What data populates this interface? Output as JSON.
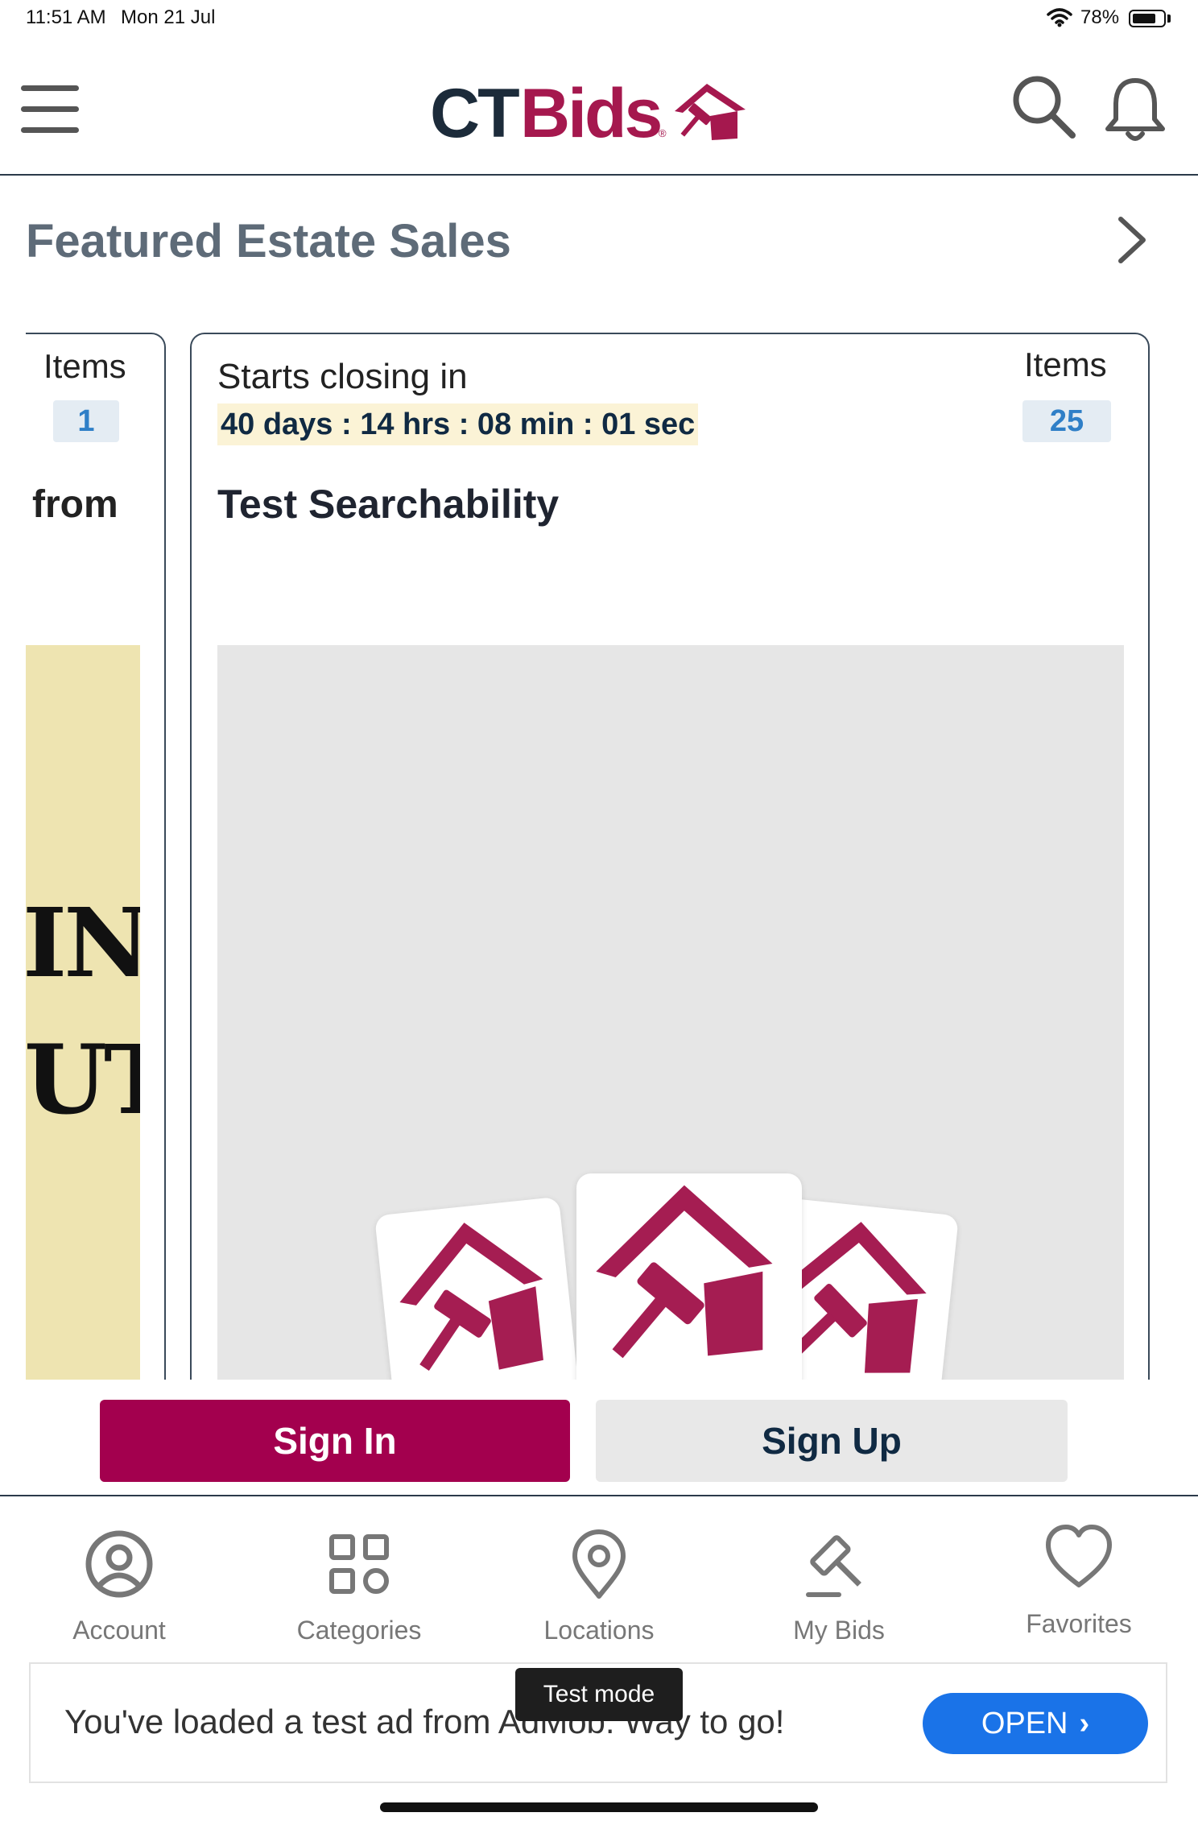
{
  "status_bar": {
    "time": "11:51 AM",
    "date": "Mon 21 Jul",
    "battery": "78%"
  },
  "header": {
    "logo_ct": "CT",
    "logo_bids": "Bids",
    "logo_reg": "®",
    "brand_color": "#a5184e",
    "dark_color": "#1c2b3a"
  },
  "section": {
    "title": "Featured Estate Sales"
  },
  "cards": [
    {
      "items_label": "Items",
      "items_count": "1",
      "from_label": "from",
      "image_text_line1": "IN",
      "image_text_line2": "UT"
    },
    {
      "closing_label": "Starts closing in",
      "countdown": "40 days : 14 hrs : 08 min : 01 sec",
      "items_label": "Items",
      "items_count": "25",
      "title": "Test Searchability"
    }
  ],
  "auth": {
    "sign_in": "Sign In",
    "sign_up": "Sign Up"
  },
  "tabs": [
    {
      "label": "Account",
      "icon": "account-icon"
    },
    {
      "label": "Categories",
      "icon": "categories-icon"
    },
    {
      "label": "Locations",
      "icon": "location-pin-icon"
    },
    {
      "label": "My Bids",
      "icon": "gavel-icon"
    },
    {
      "label": "Favorites",
      "icon": "heart-icon"
    }
  ],
  "ad": {
    "text": "You've loaded a test ad from AdMob. Way to go!",
    "open_label": "OPEN",
    "test_mode_label": "Test mode"
  }
}
